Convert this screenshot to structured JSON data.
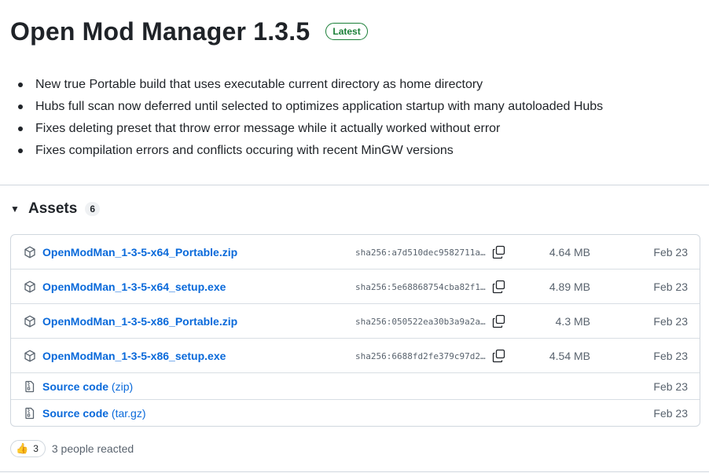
{
  "release": {
    "title": "Open Mod Manager 1.3.5",
    "badge": "Latest",
    "notes": [
      "New true Portable build that uses executable current directory as home directory",
      "Hubs full scan now deferred until selected to optimizes application startup with many autoloaded Hubs",
      "Fixes deleting preset that throw error message while it actually worked without error",
      "Fixes compilation errors and conflicts occuring with recent MinGW versions"
    ]
  },
  "assets": {
    "caret": "▼",
    "title": "Assets",
    "count": "6",
    "files": [
      {
        "name": "OpenModMan_1-3-5-x64_Portable.zip",
        "sha": "sha256:a7d510dec9582711a…",
        "size": "4.64 MB",
        "date": "Feb 23"
      },
      {
        "name": "OpenModMan_1-3-5-x64_setup.exe",
        "sha": "sha256:5e68868754cba82f1…",
        "size": "4.89 MB",
        "date": "Feb 23"
      },
      {
        "name": "OpenModMan_1-3-5-x86_Portable.zip",
        "sha": "sha256:050522ea30b3a9a2a…",
        "size": "4.3 MB",
        "date": "Feb 23"
      },
      {
        "name": "OpenModMan_1-3-5-x86_setup.exe",
        "sha": "sha256:6688fd2fe379c97d2…",
        "size": "4.54 MB",
        "date": "Feb 23"
      }
    ],
    "sources": [
      {
        "name": "Source code",
        "ext": "(zip)",
        "date": "Feb 23"
      },
      {
        "name": "Source code",
        "ext": "(tar.gz)",
        "date": "Feb 23"
      }
    ]
  },
  "reactions": {
    "emoji": "👍",
    "emoji_icon": "thumbs-up-icon",
    "count": "3",
    "text": "3 people reacted"
  },
  "icons": {
    "package": "package-icon",
    "file_zip": "file-zip-icon",
    "copy": "copy-icon"
  },
  "colors": {
    "link": "#0969da",
    "latest": "#1a7f37",
    "muted": "#59636e",
    "border": "#d0d7de"
  }
}
